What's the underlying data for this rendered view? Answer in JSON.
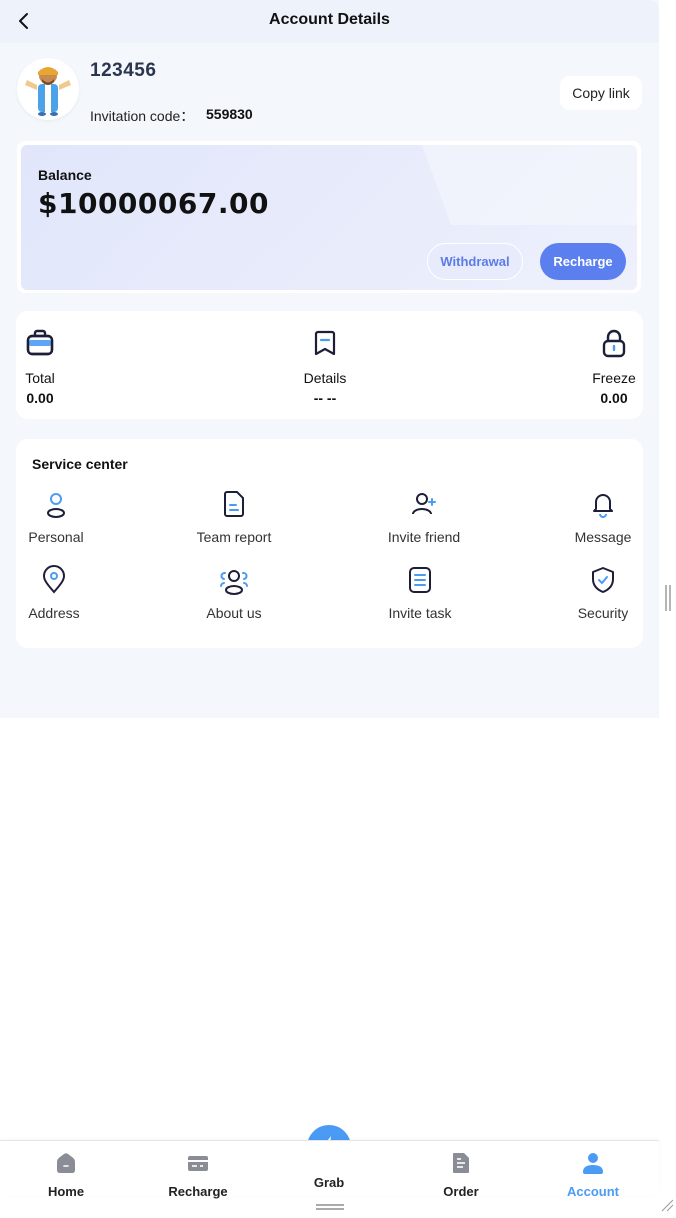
{
  "header": {
    "title": "Account Details"
  },
  "profile": {
    "username": "123456",
    "invitation_label": "Invitation code：",
    "invitation_code": "559830",
    "copy_label": "Copy link"
  },
  "balance": {
    "label": "Balance",
    "amount": "$10000067.00",
    "withdraw_label": "Withdrawal",
    "recharge_label": "Recharge"
  },
  "stats": [
    {
      "label": "Total",
      "value": "0.00",
      "icon": "briefcase-icon"
    },
    {
      "label": "Details",
      "value": "-- --",
      "icon": "bookmark-icon"
    },
    {
      "label": "Freeze",
      "value": "0.00",
      "icon": "lock-icon"
    }
  ],
  "service": {
    "title": "Service center",
    "items": [
      {
        "label": "Personal",
        "icon": "user-icon"
      },
      {
        "label": "Team report",
        "icon": "document-icon"
      },
      {
        "label": "Invite friend",
        "icon": "user-plus-icon"
      },
      {
        "label": "Message",
        "icon": "bell-icon"
      },
      {
        "label": "Address",
        "icon": "location-pin-icon"
      },
      {
        "label": "About us",
        "icon": "group-icon"
      },
      {
        "label": "Invite task",
        "icon": "task-list-icon"
      },
      {
        "label": "Security",
        "icon": "shield-icon"
      }
    ]
  },
  "tabbar": {
    "items": [
      {
        "label": "Home",
        "icon": "home-icon",
        "active": false
      },
      {
        "label": "Recharge",
        "icon": "wallet-icon",
        "active": false
      },
      {
        "label": "Grab",
        "icon": "lightning-icon",
        "active": false
      },
      {
        "label": "Order",
        "icon": "order-icon",
        "active": false
      },
      {
        "label": "Account",
        "icon": "account-icon",
        "active": true
      }
    ]
  },
  "colors": {
    "accent": "#5b7fee",
    "active_tab": "#4b9bf5",
    "page_bg": "#f4f7fc"
  }
}
